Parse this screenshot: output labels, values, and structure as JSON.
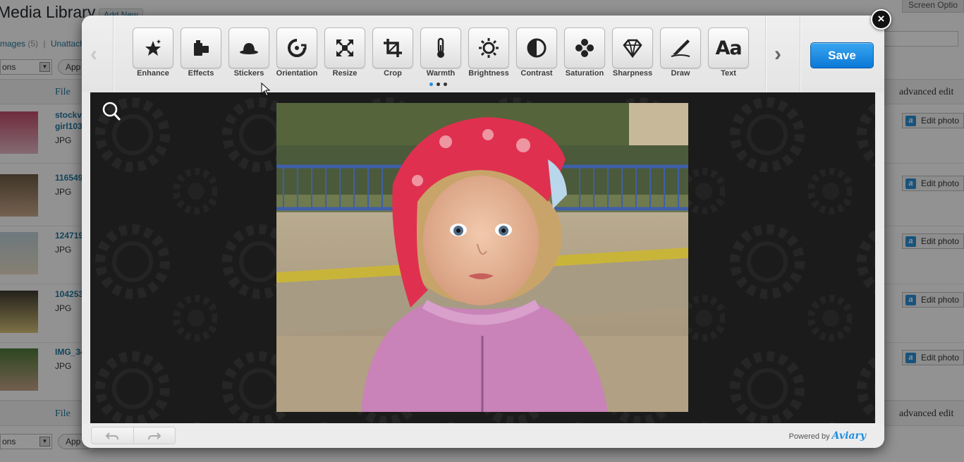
{
  "background": {
    "title": "Media Library",
    "add_new": "Add New",
    "screen_options": "Screen Optio",
    "filters": {
      "images": "mages",
      "images_count": "(5)",
      "separator": "|",
      "unattached": "Unattach"
    },
    "bulk_actions": "ons",
    "apply": "App",
    "column_file": "File",
    "column_advanced": "advanced edit",
    "rows": [
      {
        "name": "stockv",
        "name2": "girl103",
        "type": "JPG",
        "edit": "Edit photo"
      },
      {
        "name": "116549",
        "name2": "",
        "type": "JPG",
        "edit": "Edit photo"
      },
      {
        "name": "124719",
        "name2": "",
        "type": "JPG",
        "edit": "Edit photo"
      },
      {
        "name": "104253",
        "name2": "",
        "type": "JPG",
        "edit": "Edit photo"
      },
      {
        "name": "IMG_34",
        "name2": "",
        "type": "JPG",
        "edit": "Edit photo"
      }
    ]
  },
  "editor": {
    "close_label": "×",
    "save_label": "Save",
    "tools": [
      {
        "label": "Enhance",
        "icon": "enhance-icon"
      },
      {
        "label": "Effects",
        "icon": "effects-icon"
      },
      {
        "label": "Stickers",
        "icon": "stickers-icon"
      },
      {
        "label": "Orientation",
        "icon": "orientation-icon"
      },
      {
        "label": "Resize",
        "icon": "resize-icon"
      },
      {
        "label": "Crop",
        "icon": "crop-icon"
      },
      {
        "label": "Warmth",
        "icon": "warmth-icon"
      },
      {
        "label": "Brightness",
        "icon": "brightness-icon"
      },
      {
        "label": "Contrast",
        "icon": "contrast-icon"
      },
      {
        "label": "Saturation",
        "icon": "saturation-icon"
      },
      {
        "label": "Sharpness",
        "icon": "sharpness-icon"
      },
      {
        "label": "Draw",
        "icon": "draw-icon"
      },
      {
        "label": "Text",
        "icon": "text-icon"
      }
    ],
    "text_tool_glyph": "Aa",
    "pager": {
      "pages": 3,
      "active": 1
    },
    "powered_by": "Powered by",
    "brand": "Aviary",
    "colors": {
      "accent": "#1e8ee6",
      "save_top": "#3aa6f0",
      "save_bottom": "#0b78d7",
      "canvas_bg": "#1b1b1b"
    }
  }
}
